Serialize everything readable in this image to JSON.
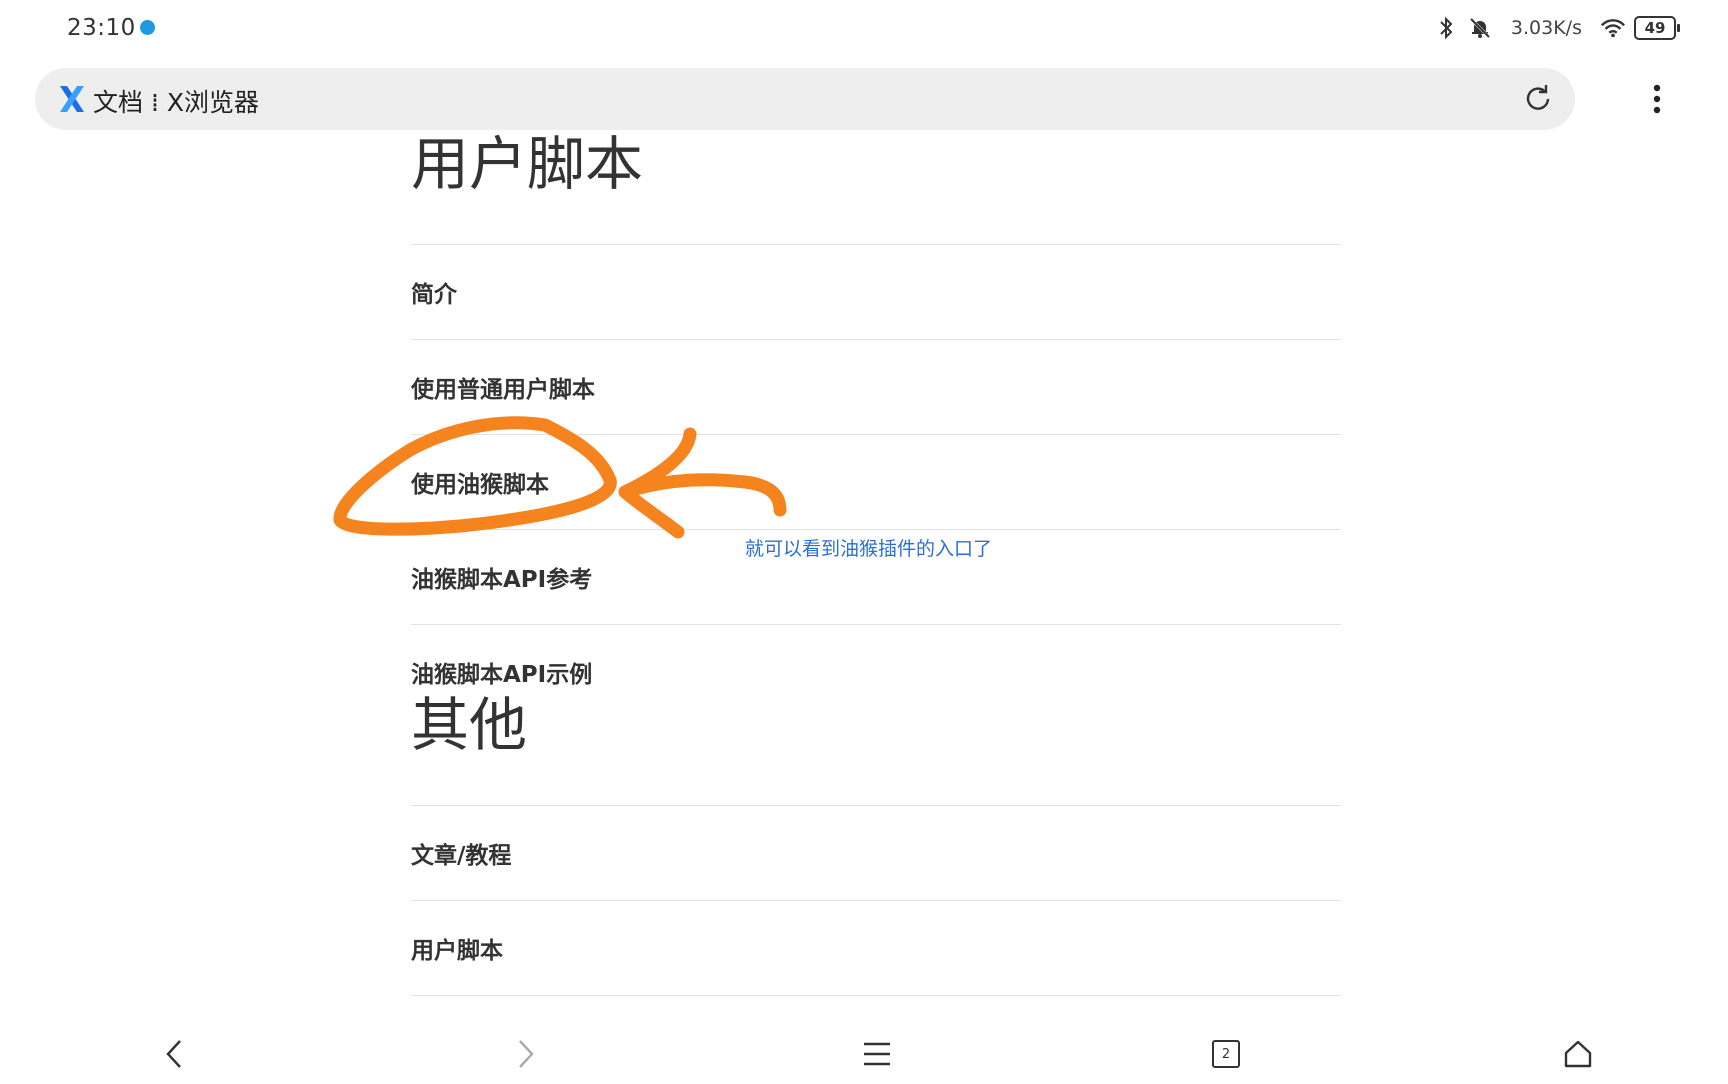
{
  "status_bar": {
    "time": "23:10",
    "net_speed": "3.03K/s",
    "battery": "49",
    "icons": [
      "globe-dot",
      "bluetooth-icon",
      "mute-bell-icon",
      "wifi-icon",
      "battery-icon"
    ]
  },
  "address_bar": {
    "logo": "x-browser-logo",
    "title": "文档 ⁞ X浏览器",
    "reload_icon": "reload-icon",
    "menu_icon": "more-vertical-icon"
  },
  "sections": [
    {
      "heading": "用户脚本",
      "items": [
        "简介",
        "使用普通用户脚本",
        "使用油猴脚本",
        "油猴脚本API参考",
        "油猴脚本API示例"
      ]
    },
    {
      "heading": "其他",
      "items": [
        "文章/教程",
        "用户脚本"
      ]
    }
  ],
  "annotation": {
    "text": "就可以看到油猴插件的入口了",
    "stroke_color": "#f5841f",
    "text_color": "#2b6fd6"
  },
  "bottom_nav": {
    "tab_count": "2",
    "icons": [
      "back-icon",
      "forward-icon",
      "menu-icon",
      "tabs-icon",
      "home-icon"
    ]
  }
}
